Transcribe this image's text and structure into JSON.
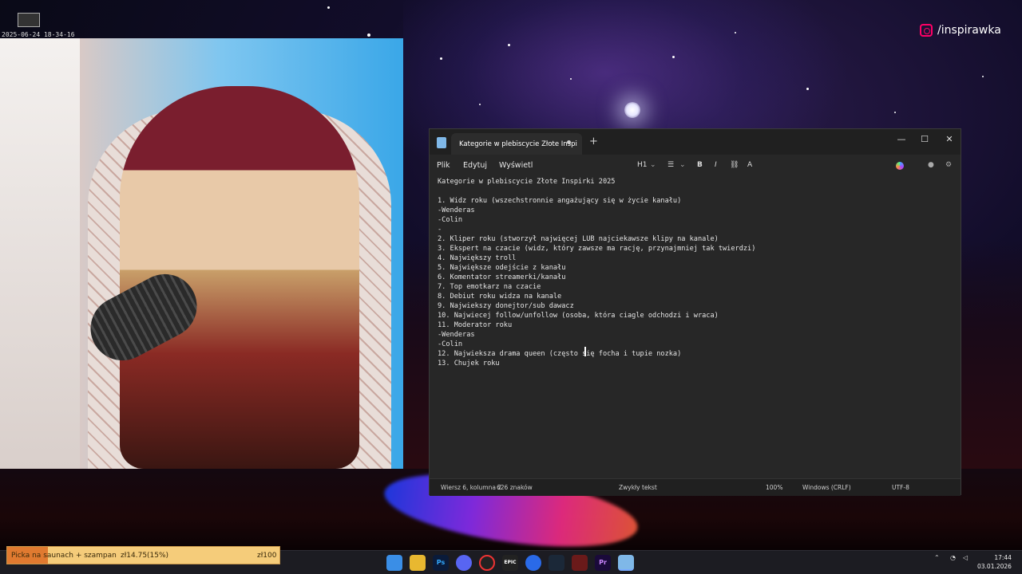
{
  "overlay": {
    "timestamp": "2025-06-24 18-34-16",
    "instagram_handle": "/inspirawka",
    "donation": {
      "title": "Picka na saunach + szampan",
      "amount_label": "zł14.75(15%)",
      "goal_label": "zł100",
      "progress_fraction": 0.15
    }
  },
  "notepad": {
    "tab_title": "Kategorie w plebiscycie Złote Inspi",
    "new_tab": "+",
    "window_controls": {
      "minimize": "—",
      "maximize": "☐",
      "close": "✕"
    },
    "menu": {
      "file": "Plik",
      "edit": "Edytuj",
      "view": "Wyświetl"
    },
    "toolbar": {
      "heading": "H1",
      "list": "☰",
      "bold": "B",
      "italic": "I",
      "link": "⛓",
      "clear": "A"
    },
    "lines": [
      "Kategorie w plebiscycie Złote Inspirki 2025",
      "",
      "1. Widz roku (wszechstronnie angażujący się w życie kanału)",
      "-Wenderas",
      "-Colin",
      "-",
      "2. Kliper roku (stworzył najwięcej LUB najciekawsze klipy na kanale)",
      "3. Ekspert na czacie (widz, który zawsze ma rację, przynajmniej tak twierdzi)",
      "4. Największy troll",
      "5. Największe odejście z kanału",
      "6. Komentator streamerki/kanału",
      "7. Top emotkarz na czacie",
      "8. Debiut roku widza na kanale",
      "9. Najwiekszy donejtor/sub dawacz",
      "10. Najwiecej follow/unfollow (osoba, która ciagle odchodzi i wraca)",
      "11. Moderator roku",
      "-Wenderas",
      "-Colin",
      "12. Najwieksza drama queen (często się focha i tupie nozka)",
      "13. Chujek roku"
    ],
    "status": {
      "position": "Wiersz 6, kolumna 2",
      "chars": "626 znaków",
      "format": "Zwykły tekst",
      "zoom": "100%",
      "line_ending": "Windows (CRLF)",
      "encoding": "UTF-8"
    }
  },
  "taskbar": {
    "icons": [
      "windows-start",
      "file-explorer",
      "photoshop",
      "discord",
      "obs",
      "epic-games",
      "unknown-app",
      "steam",
      "unknown-app-2",
      "premiere",
      "notepad"
    ],
    "clock_time": "17:44",
    "clock_date": "03.01.2026"
  },
  "colors": {
    "editor_bg": "#272727",
    "titlebar_bg": "#202020",
    "donation_bg": "#f5cc7a",
    "donation_fill": "#e07a30"
  }
}
